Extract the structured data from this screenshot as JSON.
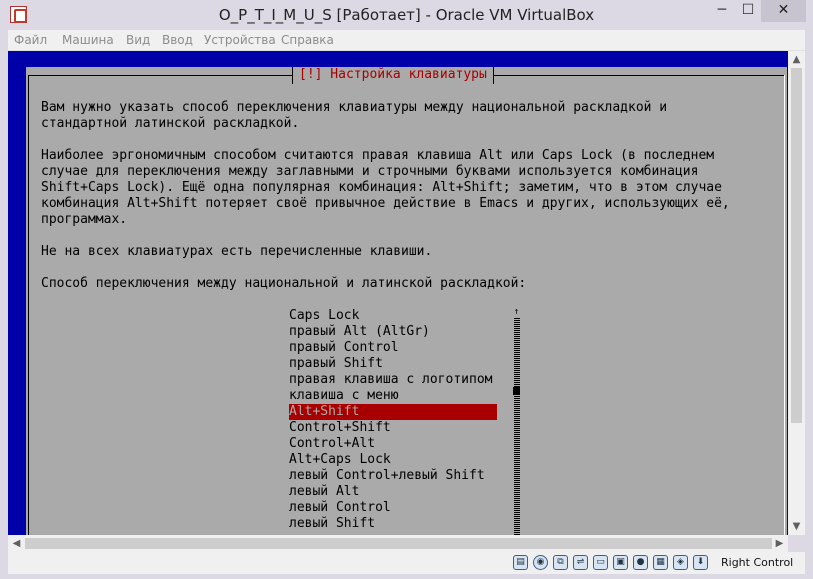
{
  "window": {
    "title": "O_P_T_I_M_U_S [Работает] - Oracle VM VirtualBox",
    "minimize": "─",
    "maximize": "☐",
    "close": "✕"
  },
  "menubar": {
    "items": [
      "Файл",
      "Машина",
      "Вид",
      "Ввод",
      "Устройства",
      "Справка"
    ]
  },
  "dialog": {
    "title": "[!] Настройка клавиатуры",
    "para1": "Вам нужно указать способ переключения клавиатуры между национальной раскладкой и\nстандартной латинской раскладкой.",
    "para2": "Наиболее эргономичным способом считаются правая клавиша Alt или Caps Lock (в последнем\nслучае для переключения между заглавными и строчными буквами используется комбинация\nShift+Caps Lock). Ещё одна популярная комбинация: Alt+Shift; заметим, что в этом случае\nкомбинация Alt+Shift потеряет своё привычное действие в Emacs и других, использующих её,\nпрограммах.",
    "para3": "Не на всех клавиатурах есть перечисленные клавиши.",
    "prompt": "Способ переключения между национальной и латинской раскладкой:",
    "options": [
      "Caps Lock",
      "правый Alt (AltGr)",
      "правый Control",
      "правый Shift",
      "правая клавиша с логотипом",
      "клавиша с меню",
      "Alt+Shift",
      "Control+Shift",
      "Control+Alt",
      "Alt+Caps Lock",
      "левый Control+левый Shift",
      "левый Alt",
      "левый Control",
      "левый Shift"
    ],
    "selected": "Alt+Shift",
    "scroll_up_glyph": "↑"
  },
  "statusbar": {
    "icons": [
      "hdd-icon",
      "optical-disc-icon",
      "network-icon",
      "usb-icon",
      "shared-folder-icon",
      "display-icon",
      "video-capture-icon",
      "cpu-icon",
      "mouse-integration-icon",
      "keyboard-capture-icon"
    ],
    "host_key": "Right Control"
  },
  "colors": {
    "vm_background": "#0000a8",
    "dialog_background": "#aaaaaa",
    "dialog_title": "#a80000",
    "selection": "#a80000"
  }
}
